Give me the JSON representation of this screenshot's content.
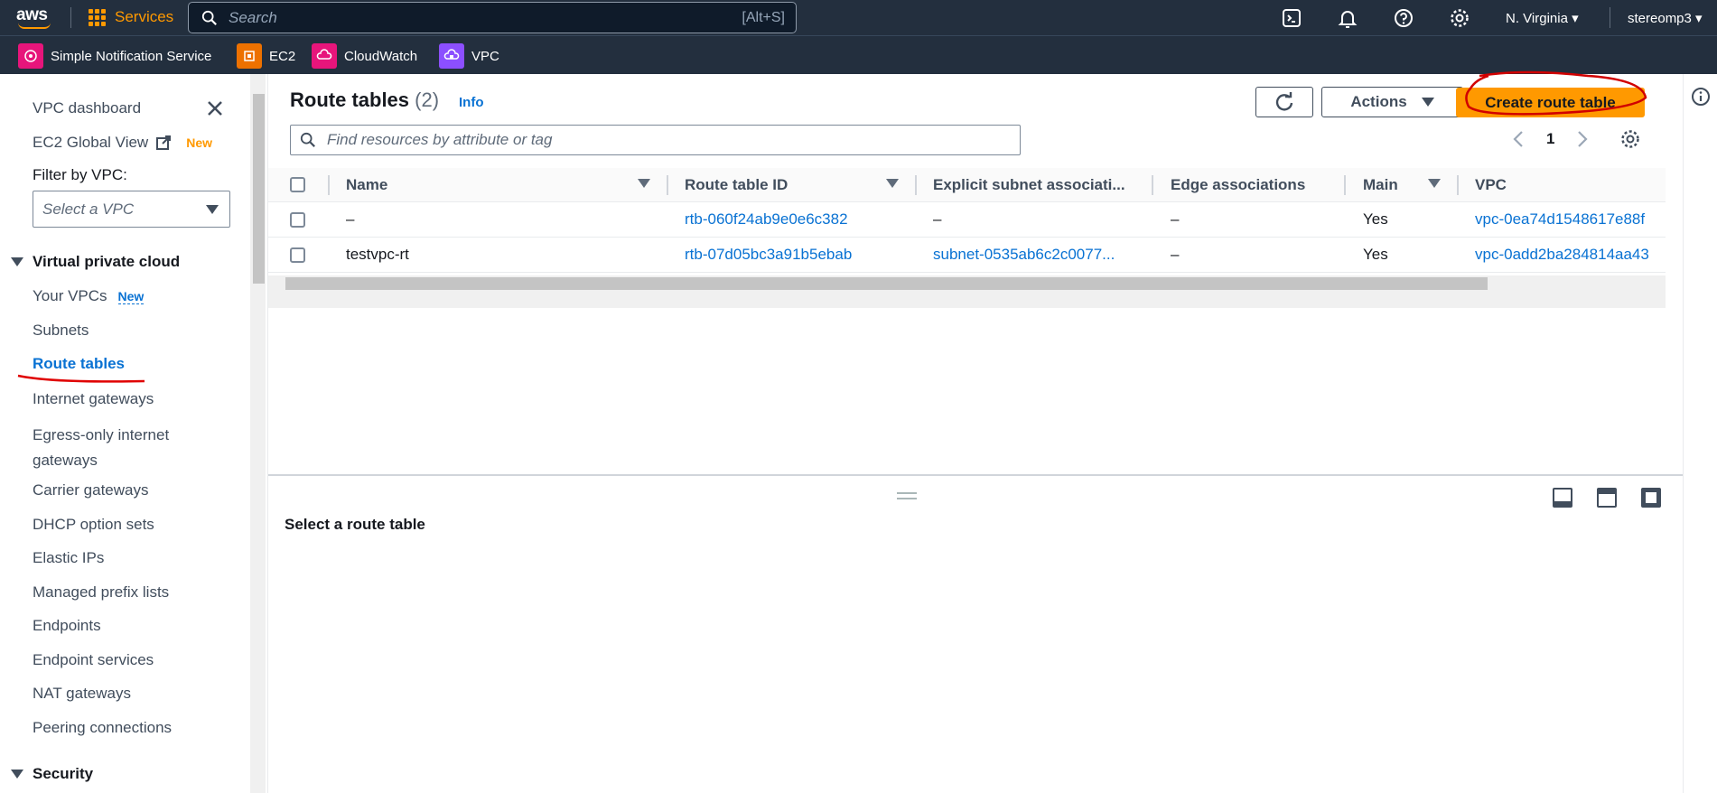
{
  "topnav": {
    "logo": "aws",
    "services": "Services",
    "search_placeholder": "Search",
    "search_shortcut": "[Alt+S]",
    "region": "N. Virginia",
    "user": "stereomp3"
  },
  "favorites": [
    {
      "label": "Simple Notification Service",
      "color": "#e7157b"
    },
    {
      "label": "EC2",
      "color": "#ed7100"
    },
    {
      "label": "CloudWatch",
      "color": "#e7157b"
    },
    {
      "label": "VPC",
      "color": "#8c4fff"
    }
  ],
  "sidebar": {
    "vpc_dashboard": "VPC dashboard",
    "ec2_global_view": "EC2 Global View",
    "ec2_global_new": "New",
    "filter_label": "Filter by VPC:",
    "filter_placeholder": "Select a VPC",
    "section_vpc": "Virtual private cloud",
    "your_vpcs": "Your VPCs",
    "your_vpcs_new": "New",
    "subnets": "Subnets",
    "route_tables": "Route tables",
    "internet_gateways": "Internet gateways",
    "egress_line1": "Egress-only internet",
    "egress_line2": "gateways",
    "carrier_gateways": "Carrier gateways",
    "dhcp": "DHCP option sets",
    "elastic_ips": "Elastic IPs",
    "prefix_lists": "Managed prefix lists",
    "endpoints": "Endpoints",
    "endpoint_services": "Endpoint services",
    "nat_gateways": "NAT gateways",
    "peering": "Peering connections",
    "section_security": "Security"
  },
  "main": {
    "title": "Route tables",
    "count": "(2)",
    "info": "Info",
    "actions": "Actions",
    "create": "Create route table",
    "filter_placeholder": "Find resources by attribute or tag",
    "page": "1"
  },
  "table": {
    "headers": {
      "name": "Name",
      "id": "Route table ID",
      "subnet": "Explicit subnet associati...",
      "edge": "Edge associations",
      "main": "Main",
      "vpc": "VPC"
    },
    "rows": [
      {
        "name": "–",
        "id": "rtb-060f24ab9e0e6c382",
        "subnet": "–",
        "edge": "–",
        "main": "Yes",
        "vpc": "vpc-0ea74d1548617e88f"
      },
      {
        "name": "testvpc-rt",
        "id": "rtb-07d05bc3a91b5ebab",
        "subnet": "subnet-0535ab6c2c0077...",
        "edge": "–",
        "main": "Yes",
        "vpc": "vpc-0add2ba284814aa43"
      }
    ]
  },
  "split": {
    "title": "Select a route table"
  },
  "colors": {
    "nav_bg": "#232f3e",
    "accent": "#ff9900",
    "link": "#0972d3"
  }
}
